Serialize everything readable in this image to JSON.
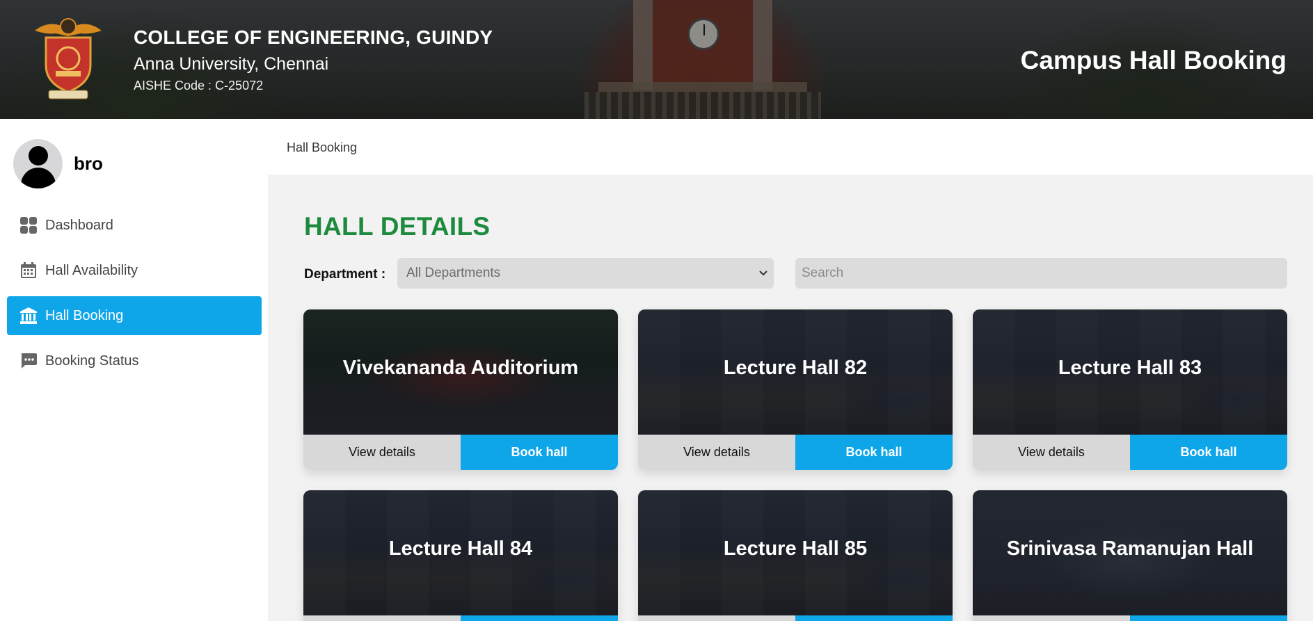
{
  "header": {
    "college_name": "COLLEGE OF ENGINEERING, GUINDY",
    "university": "Anna University, Chennai",
    "aishe_code": "AISHE Code : C-25072",
    "app_title": "Campus Hall Booking",
    "logo_icon": "college-crest-icon"
  },
  "user": {
    "name": "bro",
    "avatar_icon": "user-avatar-icon"
  },
  "sidebar": {
    "items": [
      {
        "label": "Dashboard",
        "icon": "dashboard-grid-icon",
        "active": false
      },
      {
        "label": "Hall Availability",
        "icon": "calendar-icon",
        "active": false
      },
      {
        "label": "Hall Booking",
        "icon": "building-columns-icon",
        "active": true
      },
      {
        "label": "Booking Status",
        "icon": "chat-bubble-icon",
        "active": false
      }
    ]
  },
  "breadcrumb": "Hall Booking",
  "main": {
    "title": "HALL DETAILS",
    "filter_label": "Department :",
    "department_selected": "All Departments",
    "search_placeholder": "Search",
    "view_label": "View details",
    "book_label": "Book hall",
    "halls": [
      {
        "name": "Vivekananda Auditorium"
      },
      {
        "name": "Lecture Hall 82"
      },
      {
        "name": "Lecture Hall 83"
      },
      {
        "name": "Lecture Hall 84"
      },
      {
        "name": "Lecture Hall 85"
      },
      {
        "name": "Srinivasa Ramanujan Hall"
      }
    ]
  },
  "colors": {
    "accent": "#0fa6e9",
    "title_green": "#1e8a3e",
    "secondary_button": "#d8d8d8"
  }
}
